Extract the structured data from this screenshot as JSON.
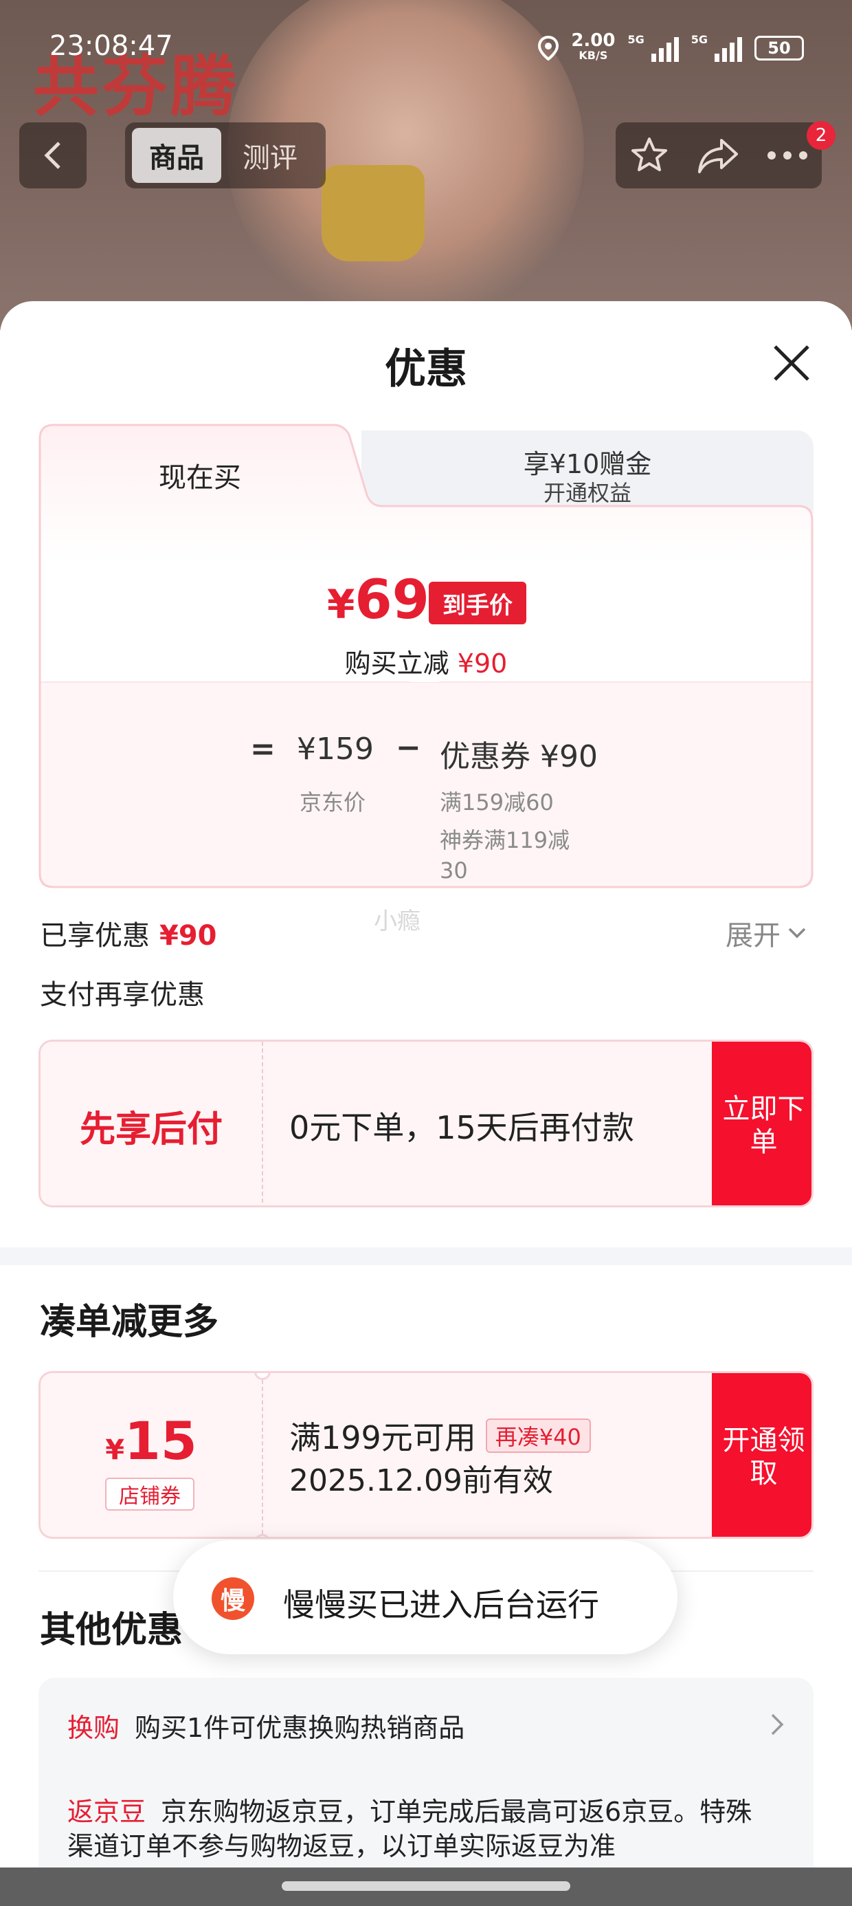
{
  "status": {
    "time": "23:08:47",
    "speed_value": "2.00",
    "speed_unit": "KB/S",
    "net1": "5G",
    "net2": "5G",
    "battery": "50"
  },
  "background": {
    "logo": "共芬腾"
  },
  "nav": {
    "tabs": [
      {
        "label": "商品",
        "active": true
      },
      {
        "label": "测评",
        "active": false
      }
    ],
    "badge": "2"
  },
  "sheet": {
    "title": "优惠"
  },
  "price_card": {
    "tab_now": "现在买",
    "tab_other_line1": "享¥10赠金",
    "tab_other_line2": "开通权益",
    "final_yen": "¥",
    "final_price": "69",
    "final_tag": "到手价",
    "reduce_label": "购买立减",
    "reduce_value": "¥90",
    "calc_eq": "=",
    "jd_price": "¥159",
    "calc_minus": "−",
    "coupon_total": "优惠券 ¥90",
    "jd_label": "京东价",
    "coupon_rule1": "满159减60",
    "coupon_rule2": "神券满119减30"
  },
  "watermark": "小瘾",
  "enjoyed": {
    "label": "已享优惠",
    "value": "¥90",
    "expand": "展开"
  },
  "pay_more": "支付再享优惠",
  "pay_later": {
    "title": "先享后付",
    "desc": "0元下单，15天后再付款",
    "button": "立即下单"
  },
  "section_more": "凑单减更多",
  "coupon": {
    "yen": "¥",
    "amount": "15",
    "type": "店铺券",
    "condition": "满199元可用",
    "more_tag": "再凑¥40",
    "expiry": "2025.12.09前有效",
    "button": "开通领取"
  },
  "section_other": "其他优惠",
  "other": [
    {
      "tag": "换购",
      "text": "购买1件可优惠换购热销商品"
    },
    {
      "tag": "返京豆",
      "text": "京东购物返京豆，订单完成后最高可返6京豆。特殊渠道订单不参与购物返豆，以订单实际返豆为准"
    }
  ],
  "toast": {
    "icon": "慢",
    "text": "慢慢买已进入后台运行"
  },
  "colors": {
    "accent": "#e61e32",
    "button": "#f5102d"
  }
}
